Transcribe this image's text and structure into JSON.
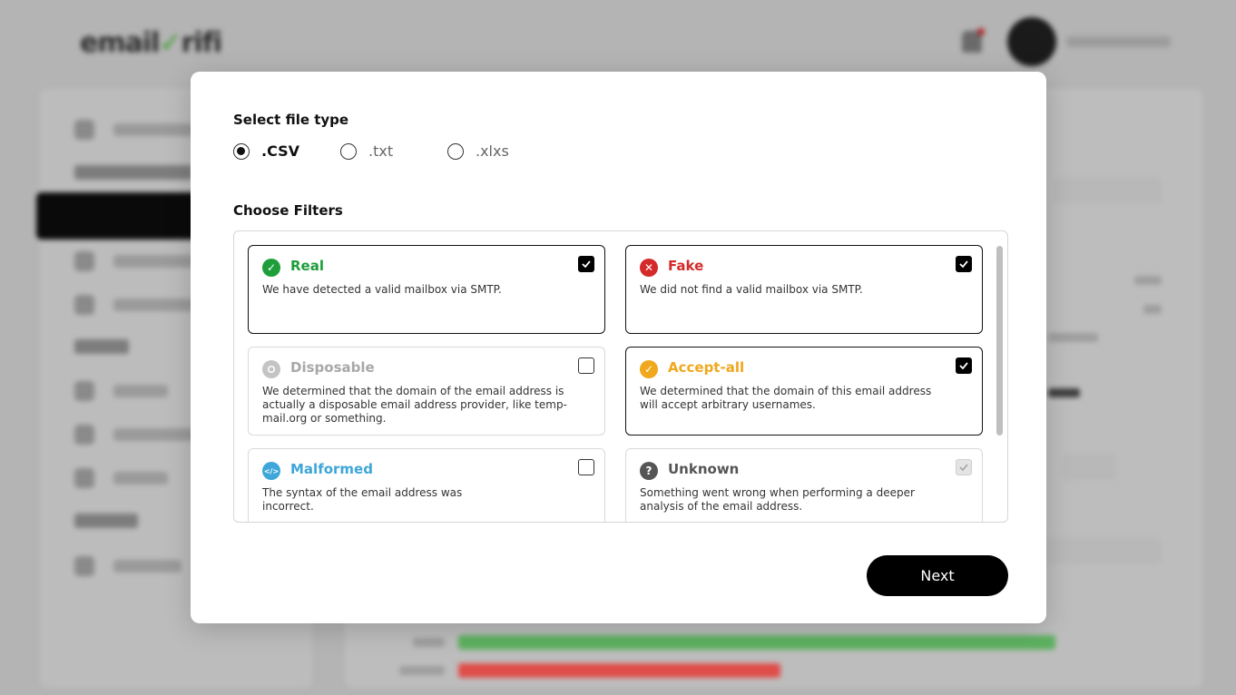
{
  "modal": {
    "file_type_label": "Select file type",
    "file_types": [
      {
        "label": ".CSV",
        "selected": true
      },
      {
        "label": ".txt",
        "selected": false
      },
      {
        "label": ".xlxs",
        "selected": false
      }
    ],
    "filters_label": "Choose Filters",
    "filters": [
      {
        "title": "Real",
        "description": "We have detected a valid mailbox via SMTP.",
        "checked": true,
        "color": "#1e9e3a",
        "icon": "check-circle-icon"
      },
      {
        "title": "Fake",
        "description": "We did not find a valid mailbox via SMTP.",
        "checked": true,
        "color": "#d42a2a",
        "icon": "x-circle-icon"
      },
      {
        "title": "Disposable",
        "description": "We determined that the domain of the email address is actually a disposable email address provider, like temp-mail.org or something.",
        "checked": false,
        "color": "#b5b5b5",
        "icon": "disposable-circle-icon"
      },
      {
        "title": "Accept-all",
        "description": "We determined that the domain of this email address will accept arbitrary usernames.",
        "checked": true,
        "color": "#f0a81c",
        "icon": "check-circle-icon"
      },
      {
        "title": "Malformed",
        "description": "The syntax of the email address was incorrect.",
        "checked": false,
        "color": "#3ea6d8",
        "icon": "code-circle-icon"
      },
      {
        "title": "Unknown",
        "description": "Something went wrong when performing a deeper analysis of the email address.",
        "checked": true,
        "disabled": true,
        "color": "#555555",
        "icon": "question-circle-icon"
      }
    ],
    "next_label": "Next"
  }
}
